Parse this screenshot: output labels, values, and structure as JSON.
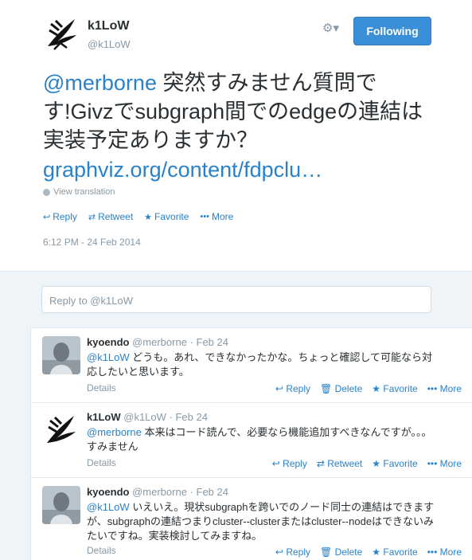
{
  "tweet": {
    "author_name": "k1LoW",
    "author_handle": "@k1LoW",
    "follow_label": "Following",
    "text_mention": "@merborne",
    "text_body": " 突然すみません質問です!Givzでsubgraph間でのedgeの連結は実装予定ありますか？",
    "link": "graphviz.org/content/fdpclu…",
    "translate_label": "View translation",
    "actions": {
      "reply": "Reply",
      "retweet": "Retweet",
      "favorite": "Favorite",
      "more": "More"
    },
    "timestamp": "6:12 PM - 24 Feb 2014"
  },
  "reply_box": {
    "placeholder": "Reply to @k1LoW"
  },
  "replies": [
    {
      "name": "kyoendo",
      "handle": "@merborne",
      "time": "· Feb 24",
      "mention": "@k1LoW",
      "text": " どうも。あれ、できなかったかな。ちょっと確認して可能なら対応したいと思います。",
      "details": "Details",
      "actions": {
        "a": "Reply",
        "b": "Delete",
        "c": "Favorite",
        "d": "More"
      }
    },
    {
      "name": "k1LoW",
      "handle": "@k1LoW",
      "time": "· Feb 24",
      "mention": "@merborne",
      "text": " 本来はコード読んで、必要なら機能追加すべきなんですが。。。すみません",
      "details": "Details",
      "actions": {
        "a": "Reply",
        "b": "Retweet",
        "c": "Favorite",
        "d": "More"
      }
    },
    {
      "name": "kyoendo",
      "handle": "@merborne",
      "time": "· Feb 24",
      "mention": "@k1LoW",
      "text": " いえいえ。現状subgraphを跨いでのノード同士の連結はできますが、subgraphの連結つまりcluster--clusterまたはcluster--nodeはできないみたいですね。実装検討してみますね。",
      "details": "Details",
      "actions": {
        "a": "Reply",
        "b": "Delete",
        "c": "Favorite",
        "d": "More"
      }
    }
  ]
}
